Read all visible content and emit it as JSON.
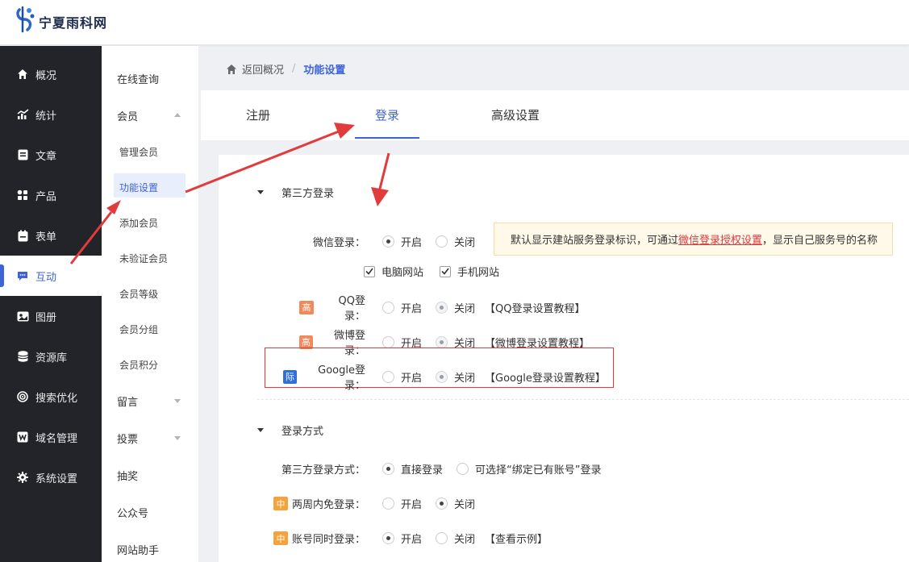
{
  "brand": {
    "name": "宁夏雨科网"
  },
  "main_nav": [
    {
      "id": "overview",
      "label": "概况",
      "icon": "home-icon"
    },
    {
      "id": "stats",
      "label": "统计",
      "icon": "chart-icon"
    },
    {
      "id": "articles",
      "label": "文章",
      "icon": "article-icon"
    },
    {
      "id": "products",
      "label": "产品",
      "icon": "grid-icon"
    },
    {
      "id": "forms",
      "label": "表单",
      "icon": "clipboard-icon"
    },
    {
      "id": "interact",
      "label": "互动",
      "icon": "chat-icon",
      "active": true
    },
    {
      "id": "gallery",
      "label": "图册",
      "icon": "image-icon"
    },
    {
      "id": "resources",
      "label": "资源库",
      "icon": "database-icon"
    },
    {
      "id": "seo",
      "label": "搜索优化",
      "icon": "target-icon"
    },
    {
      "id": "domain",
      "label": "域名管理",
      "icon": "w-icon"
    },
    {
      "id": "settings",
      "label": "系统设置",
      "icon": "gear-icon"
    }
  ],
  "sub_nav": [
    {
      "label": "在线查询",
      "level": 1
    },
    {
      "label": "会员",
      "level": 1,
      "caret": "up"
    },
    {
      "label": "管理会员",
      "level": 2
    },
    {
      "label": "功能设置",
      "level": 2,
      "selected": true
    },
    {
      "label": "添加会员",
      "level": 2
    },
    {
      "label": "未验证会员",
      "level": 2
    },
    {
      "label": "会员等级",
      "level": 2
    },
    {
      "label": "会员分组",
      "level": 2
    },
    {
      "label": "会员积分",
      "level": 2
    },
    {
      "label": "留言",
      "level": 1,
      "caret": "down"
    },
    {
      "label": "投票",
      "level": 1,
      "caret": "down"
    },
    {
      "label": "抽奖",
      "level": 1
    },
    {
      "label": "公众号",
      "level": 1
    },
    {
      "label": "网站助手",
      "level": 1
    }
  ],
  "breadcrumb": {
    "back": "返回概况",
    "sep": "/",
    "current": "功能设置"
  },
  "tabs": [
    "注册",
    "登录",
    "高级设置"
  ],
  "active_tab": 1,
  "sections": {
    "third_party": {
      "title": "第三方登录",
      "wechat": {
        "label": "微信登录：",
        "on": "开启",
        "off": "关闭",
        "pc": "电脑网站",
        "mobile": "手机网站"
      },
      "notice": {
        "prefix": "默认显示建站服务登录标识，可通过",
        "link": "微信登录授权设置",
        "suffix": "，显示自己服务号的名称"
      },
      "qq": {
        "tag": "高",
        "label": "QQ登录：",
        "on": "开启",
        "off": "关闭",
        "help": "【QQ登录设置教程】"
      },
      "weibo": {
        "tag": "高",
        "label": "微博登录：",
        "on": "开启",
        "off": "关闭",
        "help": "【微博登录设置教程】"
      },
      "google": {
        "tag": "际",
        "label": "Google登录：",
        "on": "开启",
        "off": "关闭",
        "help": "【Google登录设置教程】"
      }
    },
    "login_mode": {
      "title": "登录方式",
      "method": {
        "label": "第三方登录方式：",
        "opt1": "直接登录",
        "opt2": "可选择“绑定已有账号”登录"
      },
      "two_weeks": {
        "tag": "中",
        "label": "两周内免登录：",
        "on": "开启",
        "off": "关闭"
      },
      "same_time": {
        "tag": "中",
        "label": "账号同时登录：",
        "on": "开启",
        "off": "关闭",
        "help": "【查看示例】"
      }
    }
  },
  "colors": {
    "accent": "#3e63d6",
    "nav_bg": "#232429",
    "annotation_red": "#e23b3b",
    "notice_bg": "#fff9e9"
  }
}
